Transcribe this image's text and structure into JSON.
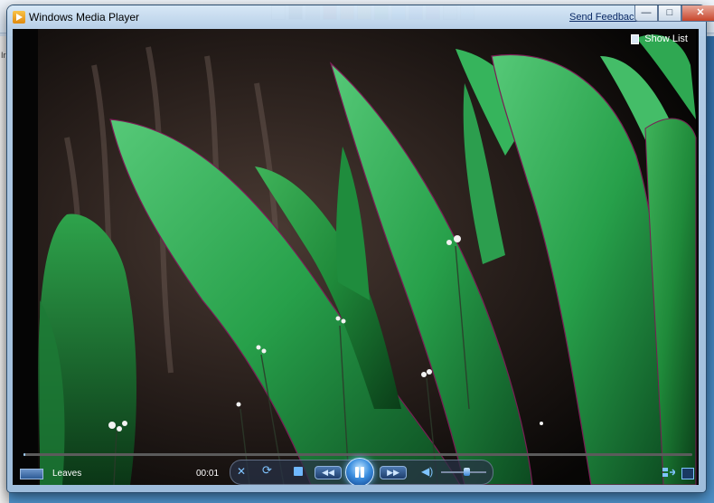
{
  "background": {
    "edge_text": "k",
    "left_strip_text": "Ir"
  },
  "window": {
    "title": "Windows Media Player",
    "feedback_link": "Send Feedback",
    "buttons": {
      "minimize": "—",
      "maximize": "□",
      "close": "✕"
    }
  },
  "video": {
    "show_list_label": "Show List"
  },
  "controls": {
    "track_title": "Leaves",
    "elapsed_time": "00:01",
    "progress_fraction": 0.003,
    "volume_fraction": 0.55,
    "icons": {
      "shuffle": "shuffle-icon",
      "repeat": "repeat-icon",
      "stop": "stop-icon",
      "previous": "previous-icon",
      "play_pause": "pause-icon",
      "next": "next-icon",
      "volume": "speaker-icon",
      "library": "switch-to-library-icon",
      "fullscreen": "fullscreen-icon"
    },
    "glyphs": {
      "shuffle": "✕",
      "repeat": "⟳",
      "previous": "◀◀",
      "next": "▶▶",
      "volume": "◀)"
    }
  },
  "colors": {
    "accent": "#3c8fe0",
    "title_bar": "#cfe0f2",
    "video_bg": "#000000"
  }
}
